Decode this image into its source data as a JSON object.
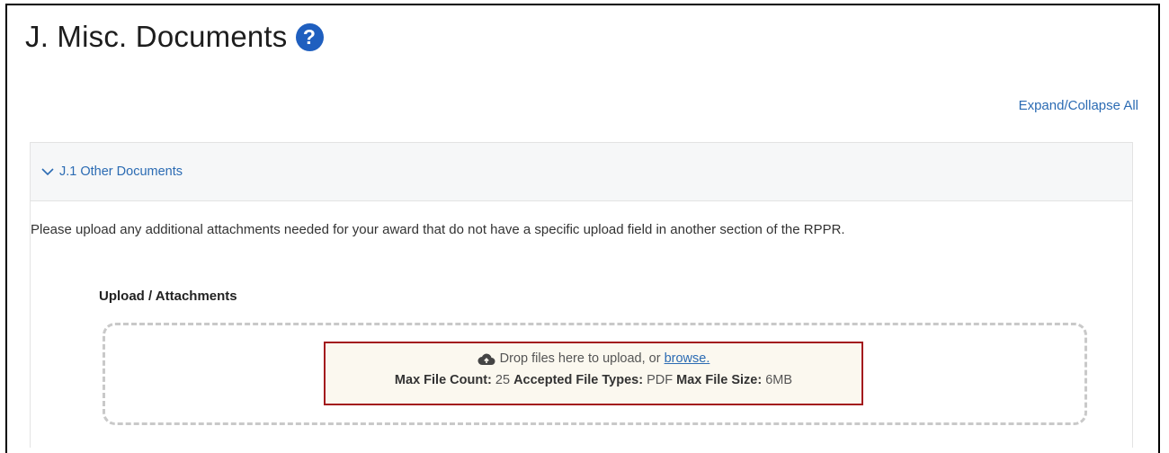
{
  "header": {
    "title": "J. Misc. Documents",
    "help_icon": "question-circle-icon",
    "expand_all_label": "Expand/Collapse All"
  },
  "section": {
    "header_label": "J.1 Other Documents",
    "chevron_icon": "chevron-down-icon",
    "instructions": "Please upload any additional attachments needed for your award that do not have a specific upload field in another section of the RPPR.",
    "upload_label": "Upload / Attachments"
  },
  "dropzone": {
    "icon": "cloud-upload-icon",
    "prompt": "Drop files here to upload, or",
    "browse_label": "browse.",
    "max_count_label": "Max File Count:",
    "max_count_value": "25",
    "types_label": "Accepted File Types:",
    "types_value": "PDF",
    "size_label": "Max File Size:",
    "size_value": "6MB"
  },
  "colors": {
    "link": "#2b6bb3",
    "help_icon_bg": "#1f5fbf",
    "highlight_border": "#a3191d"
  }
}
